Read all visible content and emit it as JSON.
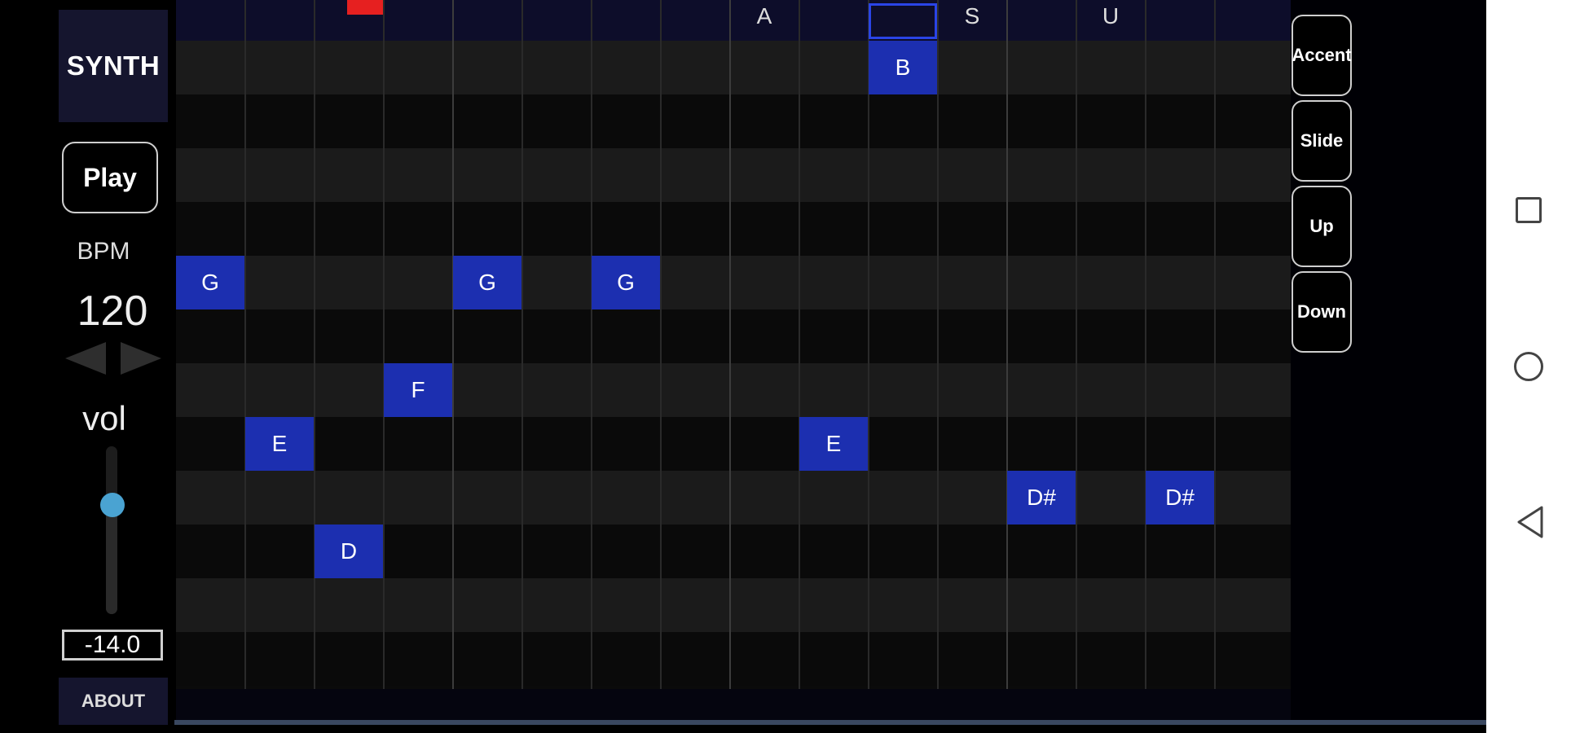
{
  "app": {
    "mode_button": "SYNTH",
    "play_button": "Play",
    "bpm_label": "BPM",
    "bpm_value": "120",
    "vol_label": "vol",
    "vol_value": "-14.0",
    "about_button": "ABOUT"
  },
  "volume_slider": {
    "level": 0.65
  },
  "step_header": {
    "letters": [
      {
        "step": 9,
        "text": "A"
      },
      {
        "step": 12,
        "text": "S"
      },
      {
        "step": 14,
        "text": "U"
      }
    ],
    "current_step": 2,
    "selected_step": 10
  },
  "notes": [
    {
      "step": 1,
      "pitch": "G"
    },
    {
      "step": 2,
      "pitch": "E"
    },
    {
      "step": 3,
      "pitch": "D"
    },
    {
      "step": 4,
      "pitch": "F"
    },
    {
      "step": 5,
      "pitch": "G"
    },
    {
      "step": 7,
      "pitch": "G"
    },
    {
      "step": 10,
      "pitch": "E"
    },
    {
      "step": 11,
      "pitch": "B"
    },
    {
      "step": 13,
      "pitch": "D#"
    },
    {
      "step": 15,
      "pitch": "D#"
    }
  ],
  "modifier_buttons": [
    "Accent",
    "Slide",
    "Up",
    "Down"
  ],
  "colors": {
    "note": "#1c2fb0",
    "selected": "#2a44e6",
    "playhead": "#e62020",
    "slider_thumb": "#4aa3d2"
  },
  "nav_icons": [
    "recent-apps-icon",
    "home-icon",
    "back-icon"
  ]
}
